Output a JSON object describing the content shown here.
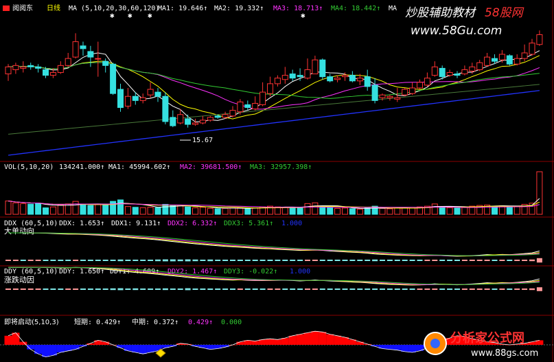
{
  "stock": {
    "name": "阅阅东",
    "period": "日线"
  },
  "colors": {
    "up": "#ff3333",
    "down": "#35e0e0",
    "white": "#ffffff",
    "yellow": "#ffff00",
    "magenta": "#ff33ff",
    "green": "#33cc33",
    "blue": "#2233ff",
    "grid": "#8b0000",
    "red": "#ff0000",
    "darkblue": "#1010ff"
  },
  "main_panel": {
    "label": "MA (5,10,20,30,60,120)",
    "ma1": "MA1: 19.646↑",
    "ma2": "MA2: 19.332↑",
    "ma3": "MA3: 18.713↑",
    "ma4": "MA4: 18.442↑",
    "ma_more": "MA",
    "low_mark": "15.67"
  },
  "vol_panel": {
    "label": "VOL(5,10,20)",
    "vol": "134241.000↑",
    "ma1": "MA1: 45994.602↑",
    "ma2": "MA2: 39681.500↑",
    "ma3": "MA3: 32957.398↑"
  },
  "ddx_panel": {
    "label": "DDX (60,5,10)",
    "ddx": "DDX: 1.653↑",
    "ddx1": "DDX1: 9.131↑",
    "ddx2": "DDX2: 6.332↑",
    "ddx3": "DDX3: 5.361↑",
    "ddx4": "1.000",
    "caption": "大单动向"
  },
  "ddy_panel": {
    "label": "DDY (60,5,10)",
    "ddy": "DDY: 1.650↑",
    "ddy1": "DDY1: 4.609↑",
    "ddy2": "DDY2: 1.467↑",
    "ddy3": "DDY3: -0.022↑",
    "ddy4": "1.000",
    "caption": "涨跌动因"
  },
  "start_panel": {
    "label": "即将启动(5,10,3)",
    "short": "短期: 0.429↑",
    "mid": "中期: 0.372↑",
    "v3": "0.429↑",
    "v4": "0.000"
  },
  "watermarks": {
    "top_title": "炒股辅助教材",
    "top_brand": "58股网",
    "top_url": "www.58Gu.com",
    "bottom_title": "分析家公式网",
    "bottom_url": "www.88gs.com"
  },
  "chart_data": {
    "type": "candlestick",
    "bars": [
      [
        19.5,
        20.0,
        19.0,
        20.2
      ],
      [
        19.8,
        20.1,
        19.5,
        20.3
      ],
      [
        19.9,
        20.0,
        19.6,
        20.4
      ],
      [
        20.1,
        20.0,
        19.8,
        20.3
      ],
      [
        20.0,
        19.9,
        19.6,
        20.2
      ],
      [
        19.8,
        19.4,
        19.2,
        20.0
      ],
      [
        19.4,
        19.6,
        19.2,
        19.9
      ],
      [
        19.6,
        20.1,
        19.5,
        20.4
      ],
      [
        20.1,
        20.6,
        20.0,
        21.0
      ],
      [
        20.7,
        21.8,
        20.6,
        22.4
      ],
      [
        21.5,
        21.3,
        20.8,
        21.8
      ],
      [
        21.1,
        20.7,
        20.0,
        21.5
      ],
      [
        20.6,
        20.6,
        19.3,
        21.8
      ],
      [
        20.4,
        20.1,
        19.6,
        20.6
      ],
      [
        20.2,
        18.1,
        18.0,
        20.3
      ],
      [
        18.4,
        17.1,
        16.8,
        18.8
      ],
      [
        17.2,
        17.9,
        17.0,
        18.5
      ],
      [
        17.9,
        17.6,
        17.3,
        18.2
      ],
      [
        17.6,
        17.8,
        17.4,
        18.1
      ],
      [
        18.0,
        18.4,
        17.8,
        18.9
      ],
      [
        18.2,
        17.9,
        17.5,
        18.5
      ],
      [
        17.9,
        16.1,
        15.9,
        18.2
      ],
      [
        16.4,
        15.8,
        15.7,
        16.9
      ],
      [
        16.0,
        16.6,
        15.9,
        17.0
      ],
      [
        16.3,
        15.9,
        15.67,
        16.6
      ],
      [
        15.9,
        16.0,
        15.8,
        16.3
      ],
      [
        16.0,
        16.2,
        15.9,
        16.5
      ],
      [
        16.2,
        16.4,
        16.1,
        16.5
      ],
      [
        16.5,
        16.4,
        16.3,
        16.6
      ],
      [
        16.4,
        16.6,
        16.3,
        16.8
      ],
      [
        16.5,
        16.9,
        16.4,
        17.2
      ],
      [
        16.8,
        17.5,
        16.6,
        17.7
      ],
      [
        17.3,
        17.1,
        16.9,
        17.6
      ],
      [
        17.0,
        17.4,
        16.9,
        17.9
      ],
      [
        17.3,
        18.2,
        17.2,
        18.9
      ],
      [
        18.1,
        18.8,
        17.9,
        19.3
      ],
      [
        18.8,
        19.2,
        18.6,
        19.4
      ],
      [
        19.1,
        19.4,
        18.8,
        20.0
      ],
      [
        19.5,
        19.2,
        19.0,
        19.8
      ],
      [
        19.4,
        19.3,
        19.0,
        19.9
      ],
      [
        19.2,
        19.8,
        19.1,
        20.6
      ],
      [
        19.5,
        20.5,
        19.5,
        20.8
      ],
      [
        20.5,
        19.3,
        19.1,
        20.6
      ],
      [
        19.3,
        19.0,
        18.9,
        19.5
      ],
      [
        19.1,
        19.2,
        18.9,
        19.4
      ],
      [
        19.3,
        19.4,
        19.0,
        19.6
      ],
      [
        19.4,
        19.0,
        18.9,
        19.7
      ],
      [
        19.0,
        19.2,
        18.7,
        19.5
      ],
      [
        19.3,
        18.6,
        18.3,
        19.8
      ],
      [
        18.7,
        17.6,
        17.4,
        19.2
      ],
      [
        17.8,
        18.0,
        17.6,
        18.1
      ],
      [
        17.8,
        17.9,
        17.6,
        18.0
      ],
      [
        17.7,
        17.8,
        17.5,
        18.5
      ],
      [
        18.0,
        18.4,
        17.9,
        18.5
      ],
      [
        18.1,
        18.5,
        18.0,
        18.9
      ],
      [
        18.5,
        18.9,
        18.4,
        19.1
      ],
      [
        18.7,
        19.2,
        18.6,
        19.6
      ],
      [
        19.4,
        20.0,
        19.3,
        20.4
      ],
      [
        19.9,
        19.3,
        19.1,
        20.1
      ],
      [
        19.4,
        19.6,
        19.3,
        19.8
      ],
      [
        19.5,
        19.4,
        19.2,
        19.7
      ],
      [
        19.5,
        19.8,
        19.4,
        20.1
      ],
      [
        19.7,
        20.0,
        19.5,
        20.3
      ],
      [
        19.8,
        20.3,
        19.7,
        20.5
      ],
      [
        20.1,
        20.7,
        20.0,
        21.0
      ],
      [
        20.6,
        20.4,
        20.2,
        20.9
      ],
      [
        20.5,
        20.9,
        20.3,
        21.2
      ],
      [
        20.8,
        20.2,
        20.1,
        20.9
      ],
      [
        20.2,
        20.6,
        20.1,
        20.9
      ],
      [
        20.6,
        21.0,
        20.4,
        21.6
      ],
      [
        20.9,
        21.7,
        20.8,
        22.0
      ],
      [
        21.6,
        22.3,
        21.5,
        22.6
      ]
    ],
    "ma_axis_low": 13.6,
    "ma_axis_high": 23.4,
    "volume": [
      72,
      62,
      58,
      55,
      60,
      35,
      40,
      52,
      56,
      70,
      52,
      48,
      55,
      50,
      70,
      78,
      42,
      38,
      36,
      38,
      36,
      54,
      48,
      50,
      40,
      35,
      38,
      32,
      30,
      32,
      34,
      36,
      30,
      34,
      40,
      44,
      40,
      38,
      36,
      34,
      58,
      62,
      42,
      36,
      32,
      34,
      30,
      28,
      34,
      44,
      32,
      30,
      34,
      36,
      34,
      40,
      44,
      56,
      40,
      36,
      34,
      40,
      44,
      48,
      50,
      44,
      46,
      40,
      44,
      54,
      60,
      230
    ],
    "ddx_bars": [
      0.1,
      0,
      -0.1,
      0,
      0,
      -0.2,
      -0.3,
      -0.3,
      -0.2,
      0,
      -0.2,
      -0.3,
      -0.3,
      -0.4,
      -0.5,
      -0.6,
      -0.5,
      -0.5,
      -0.4,
      -0.5,
      -0.6,
      -0.7,
      -0.7,
      -0.6,
      -0.7,
      -0.6,
      -0.5,
      -0.6,
      -0.5,
      -0.5,
      -0.4,
      -0.3,
      -0.5,
      -0.4,
      -0.3,
      -0.2,
      -0.4,
      -0.3,
      -0.3,
      -0.4,
      0.2,
      0.3,
      -0.4,
      -0.5,
      -0.4,
      -0.3,
      -0.4,
      -0.3,
      -0.5,
      -0.6,
      -0.4,
      -0.3,
      -0.3,
      -0.2,
      -0.2,
      -0.1,
      0.2,
      0.3,
      -0.4,
      -0.3,
      -0.2,
      0.2,
      0.3,
      0.4,
      0.5,
      -0.3,
      0.4,
      -0.2,
      0.4,
      0.5,
      0.6,
      1.6
    ],
    "ddy_bars": [
      0.2,
      0.1,
      0,
      0.1,
      0,
      -0.2,
      -0.1,
      -0.2,
      0.1,
      0.3,
      -0.2,
      -0.4,
      -0.3,
      -0.5,
      -0.6,
      -0.7,
      -0.4,
      -0.6,
      -0.3,
      -0.5,
      -0.5,
      -0.6,
      -0.5,
      -0.5,
      -0.7,
      -0.4,
      -0.3,
      -0.4,
      -0.3,
      -0.3,
      -0.2,
      0.2,
      -0.3,
      -0.2,
      -0.1,
      0.2,
      0.3,
      -0.2,
      -0.2,
      -0.3,
      0.3,
      0.4,
      -0.4,
      -0.3,
      -0.3,
      -0.2,
      -0.3,
      -0.2,
      -0.4,
      -0.5,
      -0.3,
      -0.3,
      -0.2,
      -0.2,
      -0.1,
      0.2,
      0.3,
      0.4,
      -0.3,
      -0.2,
      -0.2,
      0.3,
      0.3,
      0.4,
      0.5,
      -0.3,
      0.4,
      -0.2,
      0.4,
      0.5,
      0.6,
      1.4
    ],
    "start_osc": [
      0.6,
      0.8,
      0.2,
      -0.3,
      -0.6,
      -0.8,
      -0.7,
      -0.5,
      -0.4,
      -0.3,
      -0.1,
      0.1,
      0.3,
      0.2,
      0,
      -0.2,
      -0.4,
      -0.5,
      -0.6,
      -0.5,
      -0.4,
      -0.2,
      -0.1,
      0.1,
      0.05,
      -0.1,
      -0.2,
      -0.3,
      -0.25,
      -0.15,
      0,
      0.2,
      0.3,
      0.25,
      0.35,
      0.4,
      0.35,
      0.45,
      0.6,
      0.7,
      0.8,
      0.9,
      0.85,
      0.7,
      0.6,
      0.5,
      0.35,
      0.2,
      0.05,
      -0.1,
      -0.25,
      -0.3,
      -0.35,
      -0.45,
      -0.5,
      -0.4,
      -0.2,
      0,
      0.25,
      0.45,
      0.6,
      0.55,
      0.4,
      0.3,
      0.2,
      0.15,
      0.05,
      0,
      0.05,
      0.1,
      0.2,
      0.3
    ]
  }
}
